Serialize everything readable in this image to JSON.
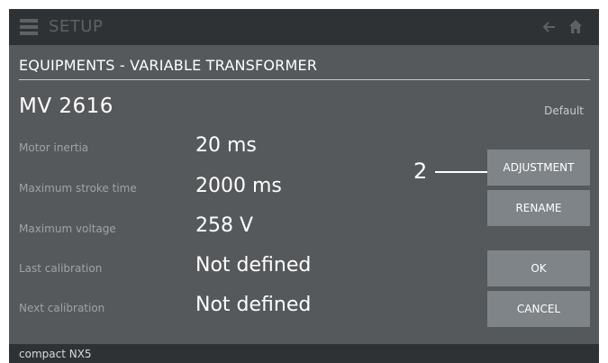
{
  "header": {
    "title": "SETUP",
    "icons": [
      "menu-icon",
      "back-arrow-icon",
      "home-icon"
    ]
  },
  "breadcrumb": "EQUIPMENTS - VARIABLE TRANSFORMER",
  "device": {
    "name": "MV 2616",
    "profile": "Default"
  },
  "params": [
    {
      "label": "Motor inertia",
      "value": "20 ms"
    },
    {
      "label": "Maximum stroke time",
      "value": "2000 ms"
    },
    {
      "label": "Maximum voltage",
      "value": "258 V"
    },
    {
      "label": "Last calibration",
      "value": "Not defined"
    },
    {
      "label": "Next calibration",
      "value": "Not defined"
    }
  ],
  "buttons": {
    "adjustment": "ADJUSTMENT",
    "rename": "RENAME",
    "ok": "OK",
    "cancel": "CANCEL"
  },
  "annotation": {
    "number": "2"
  },
  "status": {
    "text": "compact NX5"
  },
  "colors": {
    "background": "#56595b",
    "bar": "#2f3235",
    "button": "#7f8488",
    "text_primary": "#ffffff",
    "text_muted": "#9fa3a6"
  }
}
